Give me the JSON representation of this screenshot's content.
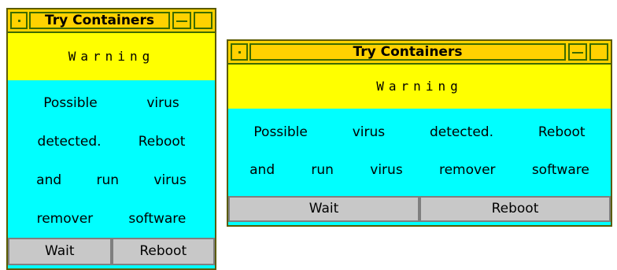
{
  "windows": [
    {
      "title": "Try Containers",
      "warning": "Warning",
      "message_rows": [
        [
          "Possible",
          "virus"
        ],
        [
          "detected.",
          "Reboot"
        ],
        [
          "and",
          "run",
          "virus"
        ],
        [
          "remover",
          "software"
        ]
      ],
      "buttons": [
        "Wait",
        "Reboot"
      ]
    },
    {
      "title": "Try Containers",
      "warning": "Warning",
      "message_rows": [
        [
          "Possible",
          "virus",
          "detected.",
          "Reboot"
        ],
        [
          "and",
          "run",
          "virus",
          "remover",
          "software"
        ]
      ],
      "buttons": [
        "Wait",
        "Reboot"
      ]
    }
  ],
  "colors": {
    "titlebar": "#ffd200",
    "warning_bg": "#ffff00",
    "body_bg": "#00ffff",
    "button_bg": "#c8c8c8"
  },
  "icons": [
    "window-menu-icon",
    "minimize-icon",
    "maximize-icon"
  ]
}
